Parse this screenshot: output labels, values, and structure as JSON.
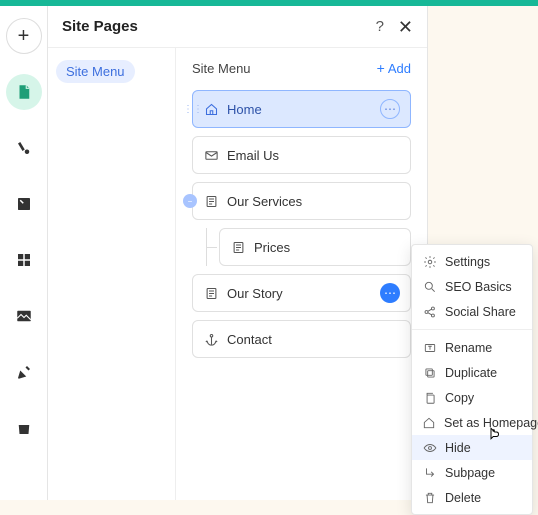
{
  "panel": {
    "title": "Site Pages",
    "side_pill": "Site Menu",
    "section_title": "Site Menu",
    "add_label": "Add"
  },
  "pages": {
    "home": "Home",
    "email": "Email Us",
    "services": "Our Services",
    "prices": "Prices",
    "story": "Our Story",
    "contact": "Contact"
  },
  "menu": {
    "settings": "Settings",
    "seo": "SEO Basics",
    "social": "Social Share",
    "rename": "Rename",
    "duplicate": "Duplicate",
    "copy": "Copy",
    "homepage": "Set as Homepage",
    "hide": "Hide",
    "subpage": "Subpage",
    "delete": "Delete"
  }
}
